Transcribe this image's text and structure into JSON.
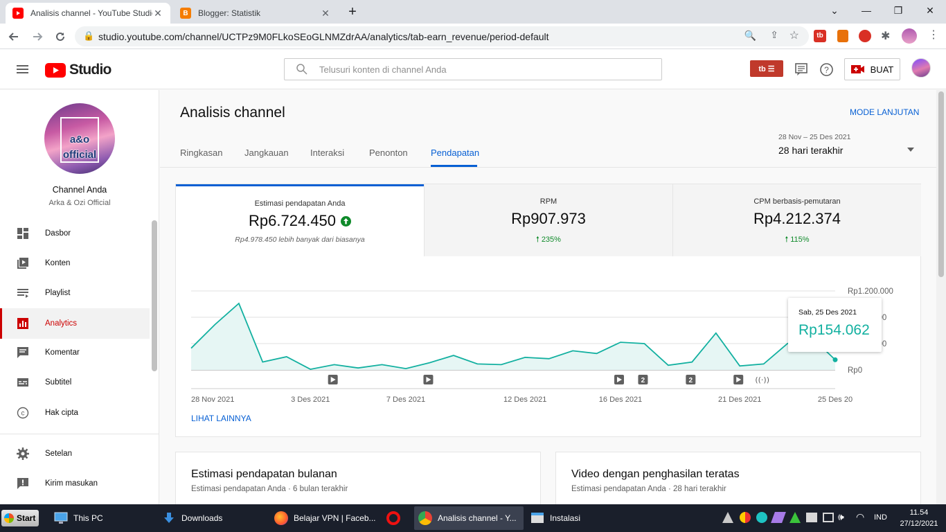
{
  "browser": {
    "tabs": [
      {
        "title": "Analisis channel - YouTube Studio",
        "active": true
      },
      {
        "title": "Blogger: Statistik",
        "active": false
      }
    ],
    "url": "studio.youtube.com/channel/UCTPz9M0FLkoSEoGLNMZdrAA/analytics/tab-earn_revenue/period-default"
  },
  "header": {
    "logo_text": "Studio",
    "search_placeholder": "Telusuri konten di channel Anda",
    "create_label": "BUAT"
  },
  "sidebar": {
    "avatar_text_line1": "a&o",
    "avatar_text_line2": "official",
    "channel_heading": "Channel Anda",
    "channel_name": "Arka & Ozi Official",
    "items": [
      {
        "label": "Dasbor",
        "icon": "dashboard-icon"
      },
      {
        "label": "Konten",
        "icon": "content-icon"
      },
      {
        "label": "Playlist",
        "icon": "playlist-icon"
      },
      {
        "label": "Analytics",
        "icon": "analytics-icon",
        "active": true
      },
      {
        "label": "Komentar",
        "icon": "comment-icon"
      },
      {
        "label": "Subtitel",
        "icon": "subtitle-icon"
      },
      {
        "label": "Hak cipta",
        "icon": "copyright-icon"
      }
    ],
    "bottom_items": [
      {
        "label": "Setelan",
        "icon": "settings-icon"
      },
      {
        "label": "Kirim masukan",
        "icon": "feedback-icon"
      }
    ]
  },
  "page": {
    "title": "Analisis channel",
    "advanced_mode": "MODE LANJUTAN",
    "date_range": "28 Nov – 25 Des 2021",
    "period_label": "28 hari terakhir",
    "tabs": [
      "Ringkasan",
      "Jangkauan",
      "Interaksi",
      "Penonton",
      "Pendapatan"
    ],
    "active_tab": "Pendapatan"
  },
  "metrics": [
    {
      "label": "Estimasi pendapatan Anda",
      "value": "Rp6.724.450",
      "sub": "Rp4.978.450 lebih banyak dari biasanya"
    },
    {
      "label": "RPM",
      "value": "Rp907.973",
      "sub": "235%"
    },
    {
      "label": "CPM berbasis-pemutaran",
      "value": "Rp4.212.374",
      "sub": "115%"
    }
  ],
  "see_more": "LIHAT LAINNYA",
  "tooltip": {
    "date": "Sab, 25 Des 2021",
    "value": "Rp154.062"
  },
  "chart_data": {
    "type": "area",
    "x": [
      "28 Nov",
      "29 Nov",
      "30 Nov",
      "1 Des",
      "2 Des",
      "3 Des",
      "4 Des",
      "5 Des",
      "6 Des",
      "7 Des",
      "8 Des",
      "9 Des",
      "10 Des",
      "11 Des",
      "12 Des",
      "13 Des",
      "14 Des",
      "15 Des",
      "16 Des",
      "17 Des",
      "18 Des",
      "19 Des",
      "20 Des",
      "21 Des",
      "22 Des",
      "23 Des",
      "24 Des",
      "25 Des"
    ],
    "values": [
      330000,
      690000,
      1010000,
      120000,
      200000,
      10000,
      80000,
      30000,
      80000,
      20000,
      110000,
      220000,
      90000,
      80000,
      190000,
      170000,
      290000,
      250000,
      420000,
      400000,
      70000,
      120000,
      560000,
      60000,
      90000,
      400000,
      500000,
      154062
    ],
    "x_tick_labels": [
      "28 Nov 2021",
      "3 Des 2021",
      "7 Des 2021",
      "12 Des 2021",
      "16 Des 2021",
      "21 Des 2021",
      "25 Des 20"
    ],
    "y_tick_labels": [
      "Rp1.200.000",
      "Rp800.000",
      "Rp400.000",
      "Rp0"
    ],
    "ylim": [
      0,
      1200000
    ],
    "grid": true,
    "color": "#12b0a0",
    "markers": [
      {
        "day_index": 6,
        "icon": "video-icon"
      },
      {
        "day_index": 10,
        "icon": "video-icon"
      },
      {
        "day_index": 18,
        "icon": "video-icon"
      },
      {
        "day_index": 19,
        "icon": "count-badge",
        "text": "2"
      },
      {
        "day_index": 21,
        "icon": "count-badge",
        "text": "2"
      },
      {
        "day_index": 23,
        "icon": "video-icon"
      },
      {
        "day_index": 24,
        "icon": "live-icon"
      }
    ]
  },
  "bottom_cards": [
    {
      "title": "Estimasi pendapatan bulanan",
      "subtitle": "Estimasi pendapatan Anda · 6 bulan terakhir"
    },
    {
      "title": "Video dengan penghasilan teratas",
      "subtitle": "Estimasi pendapatan Anda · 28 hari terakhir"
    }
  ],
  "taskbar": {
    "start": "Start",
    "items": [
      {
        "label": "This PC"
      },
      {
        "label": "Downloads"
      },
      {
        "label": "Belajar VPN | Faceb..."
      },
      {
        "label": ""
      },
      {
        "label": "Analisis channel - Y...",
        "active": true
      },
      {
        "label": "Instalasi"
      }
    ],
    "lang": "IND",
    "time": "11.54",
    "date": "27/12/2021"
  },
  "colors": {
    "accent": "#065fd4",
    "brand": "#ff0000",
    "active_nav": "#cc0000",
    "chart": "#12b0a0",
    "positive": "#0f8a2a"
  }
}
